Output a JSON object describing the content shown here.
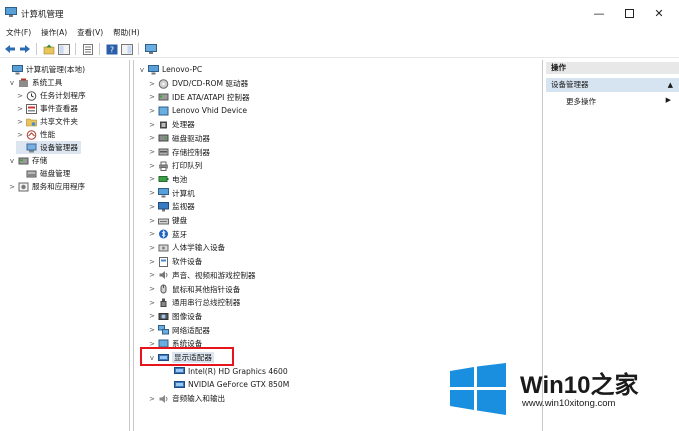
{
  "window": {
    "title": "计算机管理"
  },
  "menu": [
    "文件(F)",
    "操作(A)",
    "查看(V)",
    "帮助(H)"
  ],
  "toolbar_icons": [
    "back-arrow-icon",
    "forward-arrow-icon",
    "folder-up-icon",
    "console-tree-icon",
    "properties-icon",
    "help-icon",
    "show-hide-icon",
    "monitor-icon"
  ],
  "left_tree": [
    {
      "label": "计算机管理(本地)",
      "depth": 0,
      "chev": "",
      "icon": "computer"
    },
    {
      "label": "系统工具",
      "depth": 1,
      "chev": "v",
      "icon": "tools"
    },
    {
      "label": "任务计划程序",
      "depth": 2,
      "chev": ">",
      "icon": "clock"
    },
    {
      "label": "事件查看器",
      "depth": 2,
      "chev": ">",
      "icon": "event"
    },
    {
      "label": "共享文件夹",
      "depth": 2,
      "chev": ">",
      "icon": "folder"
    },
    {
      "label": "性能",
      "depth": 2,
      "chev": ">",
      "icon": "perf"
    },
    {
      "label": "设备管理器",
      "depth": 2,
      "chev": "",
      "icon": "devmgr",
      "selected": true
    },
    {
      "label": "存储",
      "depth": 1,
      "chev": "v",
      "icon": "storage"
    },
    {
      "label": "磁盘管理",
      "depth": 2,
      "chev": "",
      "icon": "disk"
    },
    {
      "label": "服务和应用程序",
      "depth": 1,
      "chev": ">",
      "icon": "services"
    }
  ],
  "device_tree": {
    "root": "Lenovo-PC",
    "items": [
      {
        "label": "DVD/CD-ROM 驱动器",
        "chev": ">",
        "icon": "dvd"
      },
      {
        "label": "IDE ATA/ATAPI 控制器",
        "chev": ">",
        "icon": "ide"
      },
      {
        "label": "Lenovo Vhid Device",
        "chev": ">",
        "icon": "vhid"
      },
      {
        "label": "处理器",
        "chev": ">",
        "icon": "cpu"
      },
      {
        "label": "磁盘驱动器",
        "chev": ">",
        "icon": "hdd"
      },
      {
        "label": "存储控制器",
        "chev": ">",
        "icon": "storctl"
      },
      {
        "label": "打印队列",
        "chev": ">",
        "icon": "printer"
      },
      {
        "label": "电池",
        "chev": ">",
        "icon": "battery"
      },
      {
        "label": "计算机",
        "chev": ">",
        "icon": "pc"
      },
      {
        "label": "监视器",
        "chev": ">",
        "icon": "monitor"
      },
      {
        "label": "键盘",
        "chev": ">",
        "icon": "keyboard"
      },
      {
        "label": "蓝牙",
        "chev": ">",
        "icon": "bluetooth"
      },
      {
        "label": "人体学输入设备",
        "chev": ">",
        "icon": "hid"
      },
      {
        "label": "软件设备",
        "chev": ">",
        "icon": "software"
      },
      {
        "label": "声音、视频和游戏控制器",
        "chev": ">",
        "icon": "sound"
      },
      {
        "label": "鼠标和其他指针设备",
        "chev": ">",
        "icon": "mouse"
      },
      {
        "label": "通用串行总线控制器",
        "chev": ">",
        "icon": "usb"
      },
      {
        "label": "图像设备",
        "chev": ">",
        "icon": "camera"
      },
      {
        "label": "网络适配器",
        "chev": ">",
        "icon": "network"
      },
      {
        "label": "系统设备",
        "chev": ">",
        "icon": "system"
      },
      {
        "label": "显示适配器",
        "chev": "v",
        "icon": "display",
        "highlighted": true
      },
      {
        "label": "Intel(R) HD Graphics 4600",
        "chev": "",
        "icon": "gpu",
        "child": true
      },
      {
        "label": "NVIDIA GeForce GTX 850M",
        "chev": "",
        "icon": "gpu",
        "child": true
      },
      {
        "label": "音频输入和输出",
        "chev": ">",
        "icon": "audio"
      }
    ]
  },
  "actions": {
    "header": "操作",
    "selected": "设备管理器",
    "more": "更多操作"
  },
  "watermark": {
    "brand": "Win10",
    "brand_suffix": "之家",
    "url": "www.win10xitong.com",
    "logo_color": "#1a8fe0"
  }
}
